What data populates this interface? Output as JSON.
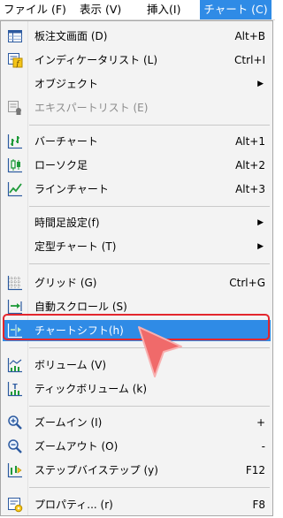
{
  "menubar": {
    "items": [
      {
        "label": "ファイル (F)"
      },
      {
        "label": "表示 (V)"
      },
      {
        "label": "挿入(I)"
      },
      {
        "label": "チャート (C)"
      }
    ]
  },
  "menu": {
    "items": [
      {
        "label": "板注文画面 (D)",
        "shortcut": "Alt+B",
        "icon": "order-book-icon"
      },
      {
        "label": "インディケータリスト (L)",
        "shortcut": "Ctrl+I",
        "icon": "indicator-list-icon"
      },
      {
        "label": "オブジェクト",
        "shortcut": "▶",
        "icon": ""
      },
      {
        "label": "エキスパートリスト (E)",
        "shortcut": "",
        "icon": "expert-list-icon"
      },
      {
        "label": "バーチャート",
        "shortcut": "Alt+1",
        "icon": "bar-chart-icon"
      },
      {
        "label": "ローソク足",
        "shortcut": "Alt+2",
        "icon": "candlestick-icon"
      },
      {
        "label": "ラインチャート",
        "shortcut": "Alt+3",
        "icon": "line-chart-icon"
      },
      {
        "label": "時間足設定(f)",
        "shortcut": "▶",
        "icon": ""
      },
      {
        "label": "定型チャート (T)",
        "shortcut": "▶",
        "icon": ""
      },
      {
        "label": "グリッド (G)",
        "shortcut": "Ctrl+G",
        "icon": "grid-icon"
      },
      {
        "label": "自動スクロール (S)",
        "shortcut": "",
        "icon": "auto-scroll-icon"
      },
      {
        "label": "チャートシフト(h)",
        "shortcut": "",
        "icon": "chart-shift-icon"
      },
      {
        "label": "ボリューム (V)",
        "shortcut": "",
        "icon": "volume-icon"
      },
      {
        "label": "ティックボリューム (k)",
        "shortcut": "",
        "icon": "tick-volume-icon"
      },
      {
        "label": "ズームイン (I)",
        "shortcut": "+",
        "icon": "zoom-in-icon"
      },
      {
        "label": "ズームアウト (O)",
        "shortcut": "-",
        "icon": "zoom-out-icon"
      },
      {
        "label": "ステップバイステップ (y)",
        "shortcut": "F12",
        "icon": "step-by-step-icon"
      },
      {
        "label": "プロパティ... (r)",
        "shortcut": "F8",
        "icon": "properties-icon"
      }
    ]
  },
  "colors": {
    "accent": "#2f8be6",
    "annotation": "#e3262d",
    "cursor": "#f06a6a"
  }
}
